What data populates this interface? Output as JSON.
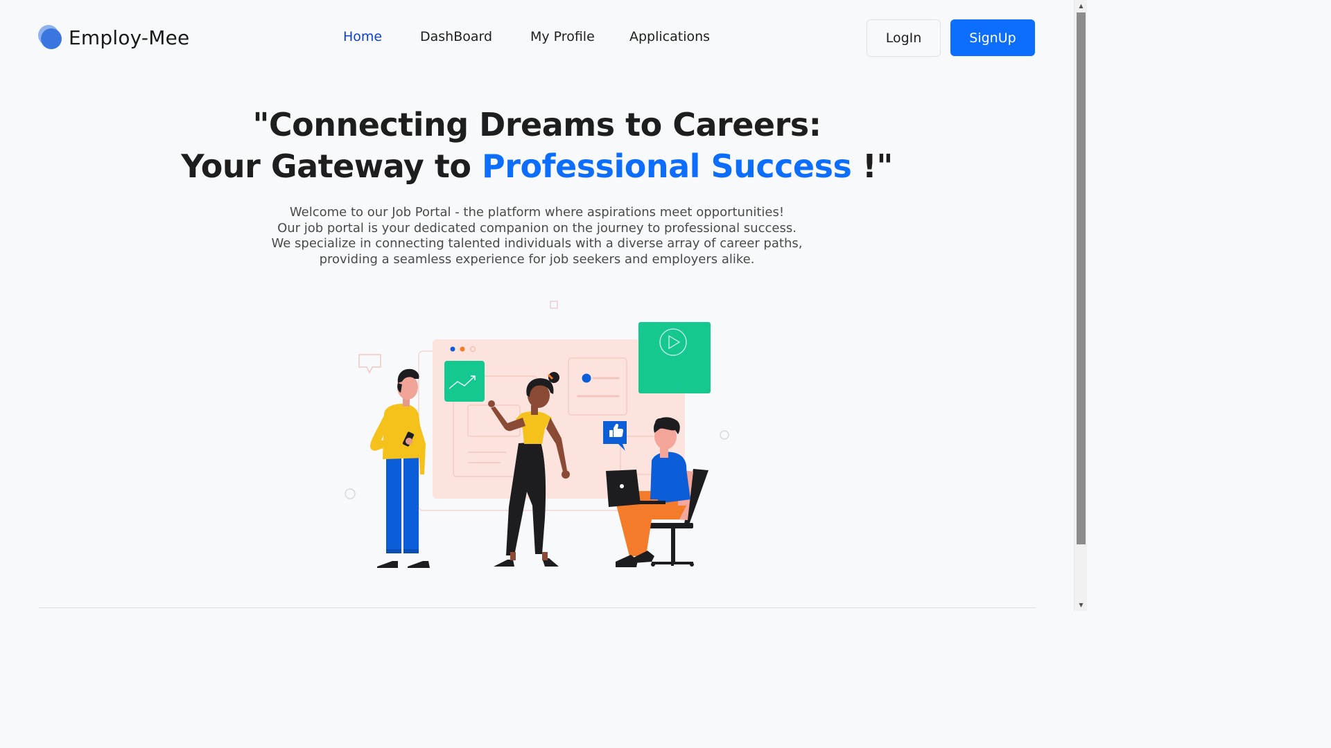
{
  "brand": {
    "name": "Employ-Mee",
    "logo_icon": "double-circle-logo"
  },
  "nav": {
    "items": [
      {
        "label": "Home",
        "active": true
      },
      {
        "label": "DashBoard",
        "active": false
      },
      {
        "label": "My Profile",
        "active": false
      },
      {
        "label": "Applications",
        "active": false
      }
    ]
  },
  "auth": {
    "login_label": "LogIn",
    "signup_label": "SignUp"
  },
  "hero": {
    "title_line1": "\"Connecting Dreams to Careers:",
    "title_line2_pre": "Your Gateway to ",
    "title_line2_accent": "Professional Success",
    "title_line2_post": " !\"",
    "subtitle_lines": [
      "Welcome to our Job Portal - the platform where aspirations meet opportunities!",
      "Our job portal is your dedicated companion on the journey to professional success.",
      "We specialize in connecting talented individuals with a diverse array of career paths,",
      "providing a seamless experience for job seekers and employers alike."
    ]
  },
  "colors": {
    "accent": "#0d6efd",
    "nav_active": "#0d3fd8",
    "illustration_green": "#14c88f",
    "illustration_pink": "#fde3de",
    "illustration_yellow": "#f5c21b",
    "illustration_blue": "#0b5ed7",
    "illustration_orange": "#f47b2a"
  },
  "illustration": {
    "icons": [
      "chart-icon",
      "play-icon",
      "thumbs-up-icon",
      "chat-bubble-icon",
      "laptop-icon",
      "phone-icon"
    ]
  }
}
